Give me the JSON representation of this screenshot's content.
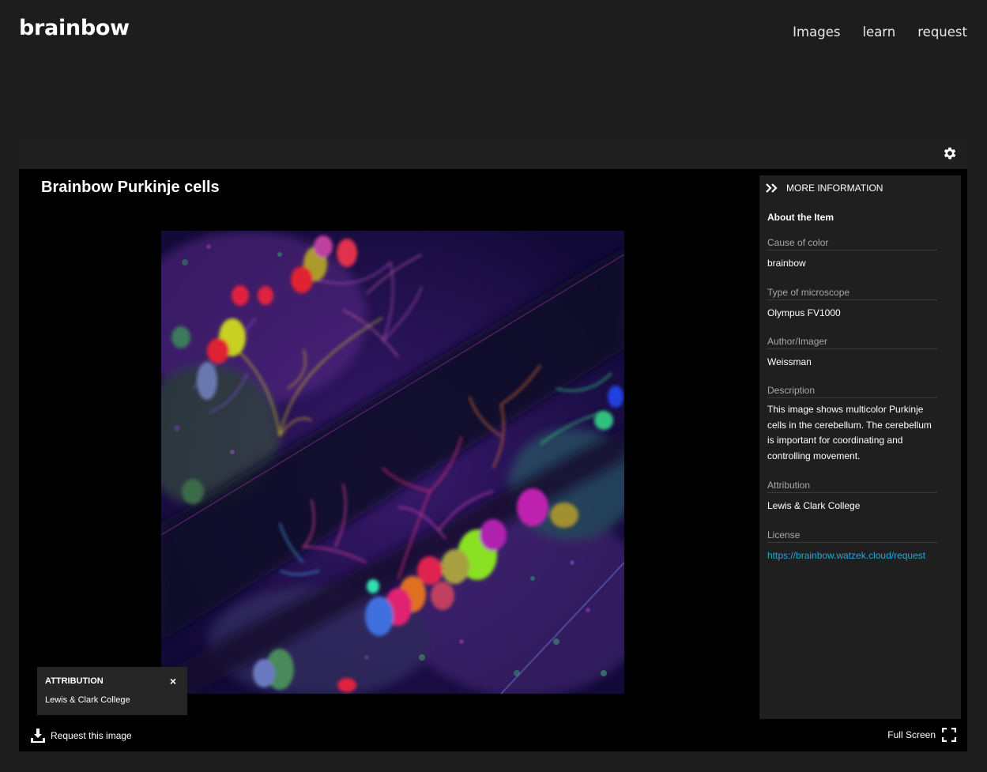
{
  "site": {
    "logo": "brainbow",
    "nav": [
      "Images",
      "learn",
      "request"
    ]
  },
  "viewer": {
    "title": "Brainbow Purkinje cells",
    "request_label": "Request this image",
    "fullscreen_label": "Full Screen",
    "attribution_box": {
      "title": "ATTRIBUTION",
      "close": "×",
      "text": "Lewis & Clark College"
    }
  },
  "info": {
    "header": "MORE INFORMATION",
    "section_title": "About the Item",
    "fields": [
      {
        "label": "Cause of color",
        "value": "brainbow"
      },
      {
        "label": "Type of microscope",
        "value": "Olympus FV1000"
      },
      {
        "label": "Author/Imager",
        "value": "Weissman"
      },
      {
        "label": "Description",
        "value": "This image shows multicolor Purkinje cells in the cerebellum. The cerebellum is important for coordinating and controlling movement."
      },
      {
        "label": "Attribution",
        "value": "Lewis & Clark College"
      },
      {
        "label": "License",
        "value": "https://brainbow.watzek.cloud/request"
      }
    ]
  },
  "colors": {
    "background": "#1d1d1d",
    "viewer": "#000000",
    "panel": "#1f1f1f",
    "link": "#2aa5d8"
  },
  "icons": {
    "settings": "gear-icon",
    "expand": "double-chevron-right-icon",
    "download": "download-icon",
    "fullscreen": "fullscreen-icon",
    "close": "close-icon"
  }
}
